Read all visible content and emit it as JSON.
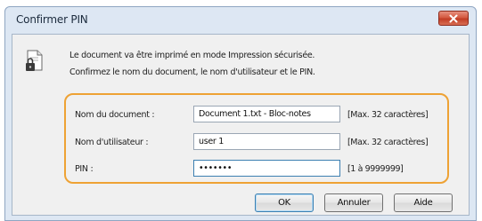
{
  "window": {
    "title": "Confirmer PIN"
  },
  "message": {
    "line1": "Le document va être imprimé en mode Impression sécurisée.",
    "line2": "Confirmez le nom du document, le nom d'utilisateur et le PIN."
  },
  "fields": {
    "document_name": {
      "label": "Nom du document :",
      "value": "Document 1.txt - Bloc-notes",
      "hint": "[Max. 32 caractères]"
    },
    "user_name": {
      "label": "Nom d'utilisateur :",
      "value": "user 1",
      "hint": "[Max. 32 caractères]"
    },
    "pin": {
      "label": "PIN :",
      "value": "•••••••",
      "hint": "[1 à 9999999]"
    }
  },
  "buttons": {
    "ok": "OK",
    "cancel": "Annuler",
    "help": "Aide"
  },
  "colors": {
    "highlight": "#eea234",
    "close_button": "#c94a33"
  },
  "icons": {
    "close": "close-icon",
    "document": "document-lock-icon"
  }
}
